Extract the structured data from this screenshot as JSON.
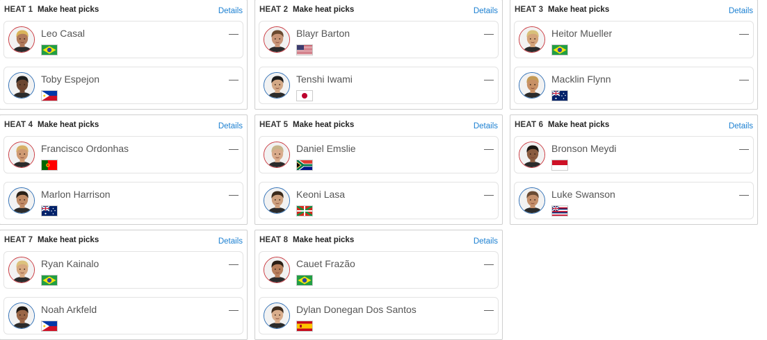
{
  "picks_label": "Make heat picks",
  "details_label": "Details",
  "heats": [
    {
      "label": "HEAT 1",
      "surfers": [
        {
          "name": "Leo Casal",
          "score": "—",
          "flag": "brazil",
          "avatar_color": "#b07a5a",
          "hair": "#d9b45a"
        },
        {
          "name": "Toby Espejon",
          "score": "—",
          "flag": "philippines",
          "avatar_color": "#6b4631",
          "hair": "#1d1d1d"
        }
      ]
    },
    {
      "label": "HEAT 2",
      "surfers": [
        {
          "name": "Blayr Barton",
          "score": "—",
          "flag": "usa",
          "avatar_color": "#c89577",
          "hair": "#6a4a30"
        },
        {
          "name": "Tenshi Iwami",
          "score": "—",
          "flag": "japan",
          "avatar_color": "#d3a886",
          "hair": "#1a1a1a"
        }
      ]
    },
    {
      "label": "HEAT 3",
      "surfers": [
        {
          "name": "Heitor Mueller",
          "score": "—",
          "flag": "brazil",
          "avatar_color": "#d4a47a",
          "hair": "#d8c07a"
        },
        {
          "name": "Macklin Flynn",
          "score": "—",
          "flag": "australia",
          "avatar_color": "#c89065",
          "hair": "#c49a56"
        }
      ]
    },
    {
      "label": "HEAT 4",
      "surfers": [
        {
          "name": "Francisco Ordonhas",
          "score": "—",
          "flag": "portugal",
          "avatar_color": "#cf9a73",
          "hair": "#d7b068"
        },
        {
          "name": "Marlon Harrison",
          "score": "—",
          "flag": "australia",
          "avatar_color": "#c08b66",
          "hair": "#2a2118"
        }
      ]
    },
    {
      "label": "HEAT 5",
      "surfers": [
        {
          "name": "Daniel Emslie",
          "score": "—",
          "flag": "southafrica",
          "avatar_color": "#d9ab8c",
          "hair": "#c7b48a"
        },
        {
          "name": "Keoni Lasa",
          "score": "—",
          "flag": "basque",
          "avatar_color": "#cda07e",
          "hair": "#3a2a1c"
        }
      ]
    },
    {
      "label": "HEAT 6",
      "surfers": [
        {
          "name": "Bronson Meydi",
          "score": "—",
          "flag": "indonesia",
          "avatar_color": "#8a5c40",
          "hair": "#1c1712"
        },
        {
          "name": "Luke Swanson",
          "score": "—",
          "flag": "hawaii",
          "avatar_color": "#c48f6b",
          "hair": "#6a4b33"
        }
      ]
    },
    {
      "label": "HEAT 7",
      "surfers": [
        {
          "name": "Ryan Kainalo",
          "score": "—",
          "flag": "brazil",
          "avatar_color": "#d6a880",
          "hair": "#dcc27e"
        },
        {
          "name": "Noah Arkfeld",
          "score": "—",
          "flag": "philippines",
          "avatar_color": "#9a6646",
          "hair": "#1d1712"
        }
      ]
    },
    {
      "label": "HEAT 8",
      "surfers": [
        {
          "name": "Cauet Frazão",
          "score": "—",
          "flag": "brazil",
          "avatar_color": "#b77f5c",
          "hair": "#2a1f16"
        },
        {
          "name": "Dylan Donegan Dos Santos",
          "score": "—",
          "flag": "spain",
          "avatar_color": "#d9ad8c",
          "hair": "#3e2c1e"
        }
      ]
    }
  ]
}
